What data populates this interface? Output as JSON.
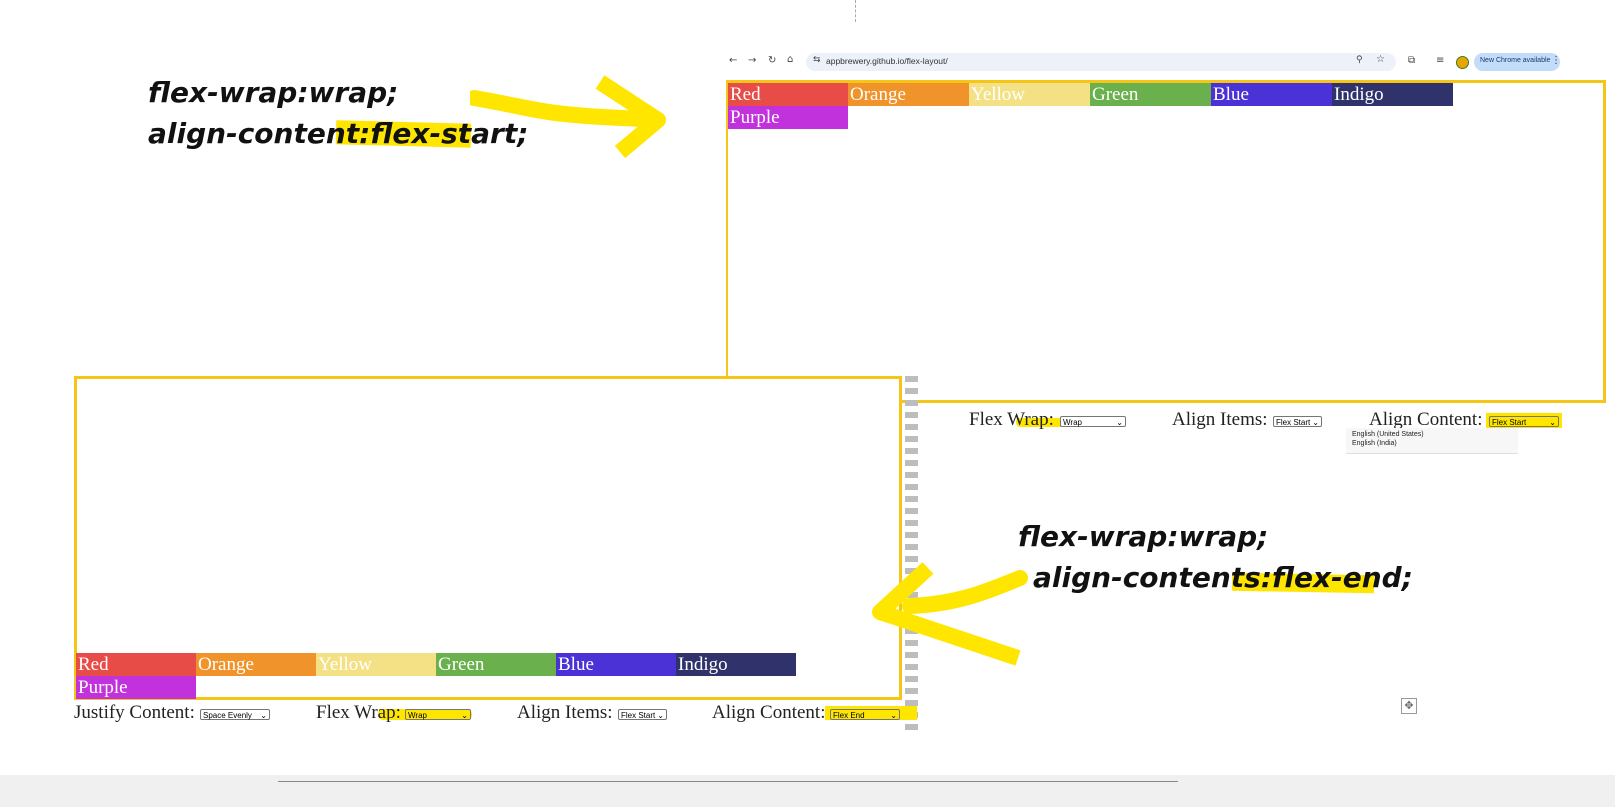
{
  "annotations": {
    "top": {
      "line1": "flex-wrap:wrap;",
      "line2_prefix": "align-content:",
      "line2_value": "flex-start;"
    },
    "bottom": {
      "line1": "flex-wrap:wrap;",
      "line2_prefix": "align-contents:",
      "line2_value": "flex-end;"
    }
  },
  "browser": {
    "url": "appbrewery.github.io/flex-layout/",
    "update_badge": "New Chrome available"
  },
  "boxes": [
    {
      "label": "Red",
      "color": "#e84c47"
    },
    {
      "label": "Orange",
      "color": "#f0932b"
    },
    {
      "label": "Yellow",
      "color": "#f4e185"
    },
    {
      "label": "Green",
      "color": "#6ab04c"
    },
    {
      "label": "Blue",
      "color": "#4b32d6"
    },
    {
      "label": "Indigo",
      "color": "#30336b"
    },
    {
      "label": "Purple",
      "color": "#c232dc"
    }
  ],
  "top_controls": {
    "flex_wrap_label": "Flex Wrap:",
    "flex_wrap_value": "Wrap",
    "align_items_label": "Align Items:",
    "align_items_value": "Flex Start",
    "align_content_label": "Align Content:",
    "align_content_value": "Flex Start",
    "language_options": [
      "English (United States)",
      "English (India)"
    ]
  },
  "bottom_controls": {
    "justify_label": "Justify Content:",
    "justify_value": "Space Evenly",
    "flex_wrap_label": "Flex Wrap:",
    "flex_wrap_value": "Wrap",
    "align_items_label": "Align Items:",
    "align_items_value": "Flex Start",
    "align_content_label": "Align Content:",
    "align_content_value": "Flex End"
  },
  "colors": {
    "highlight": "#ffe600",
    "frame": "#f5c518"
  }
}
